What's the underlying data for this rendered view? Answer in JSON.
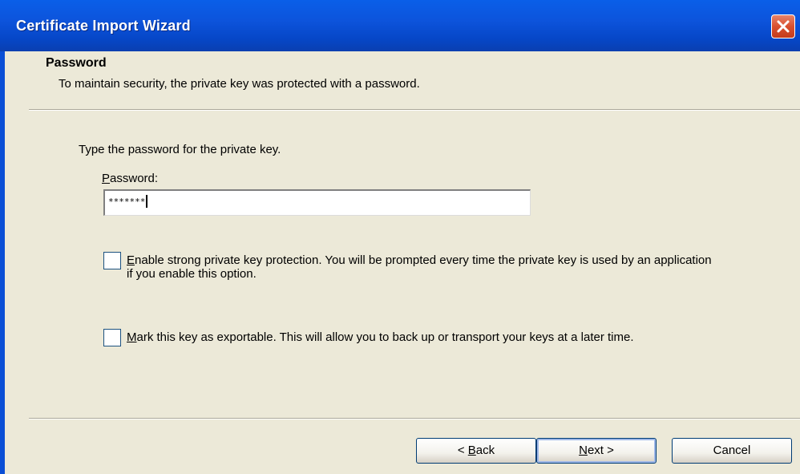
{
  "window": {
    "title": "Certificate Import Wizard"
  },
  "header": {
    "title": "Password",
    "subtitle": "To maintain security, the private key was protected with a password."
  },
  "body": {
    "prompt": "Type the password for the private key.",
    "password_label_mnemonic": "P",
    "password_label_rest": "assword:",
    "password_value": "*******",
    "option_strong_protection": {
      "checked": false,
      "mnemonic": "E",
      "text": "nable strong private key protection. You will be prompted every time the private key is used by an application if you enable this option."
    },
    "option_exportable": {
      "checked": false,
      "mnemonic": "M",
      "text": "ark this key as exportable. This will allow you to back up or transport your keys at a later time."
    }
  },
  "buttons": {
    "back_prefix": "< ",
    "back_mnemonic": "B",
    "back_rest": "ack",
    "next_mnemonic": "N",
    "next_rest": "ext >",
    "cancel": "Cancel"
  },
  "icons": {
    "close": "close-icon"
  },
  "colors": {
    "titlebar": "#0a54dc",
    "close_button": "#d9502f",
    "dialog_background": "#ece9d8"
  }
}
